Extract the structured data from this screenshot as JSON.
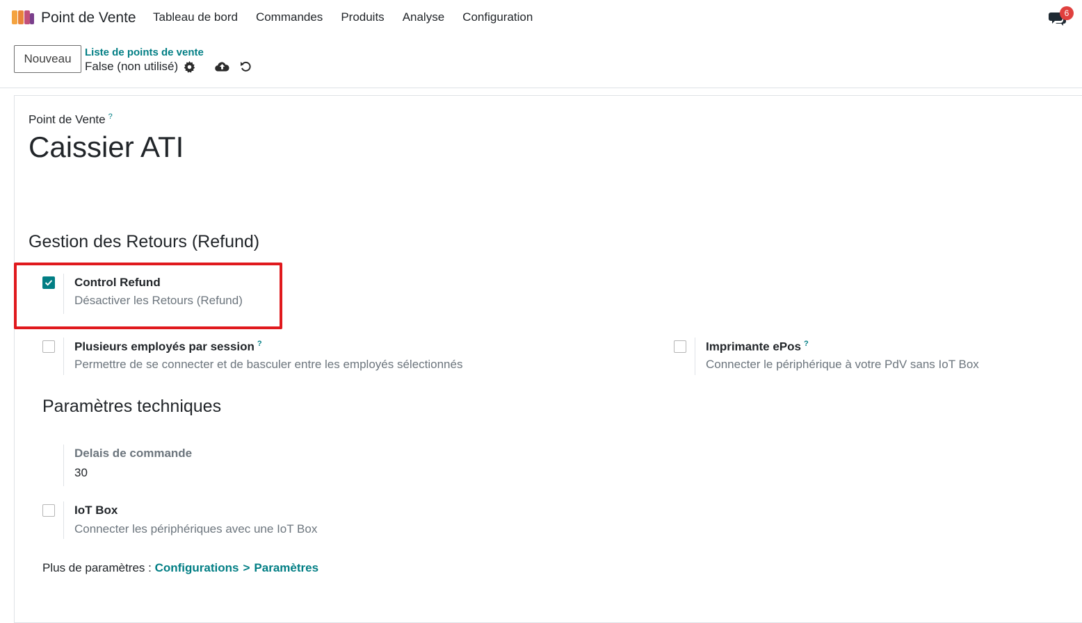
{
  "navbar": {
    "app_name": "Point de Vente",
    "menu": [
      "Tableau de bord",
      "Commandes",
      "Produits",
      "Analyse",
      "Configuration"
    ],
    "messages_count": "6"
  },
  "control_panel": {
    "new_button": "Nouveau",
    "breadcrumb": "Liste de points de vente",
    "record_name": "False (non utilisé)"
  },
  "form": {
    "field_label": "Point de Vente",
    "help_mark": "?",
    "title": "Caissier ATI",
    "section_refund": "Gestion des Retours (Refund)",
    "control_refund": {
      "label": "Control Refund",
      "description": "Désactiver les Retours (Refund)",
      "checked": true
    },
    "multi_employees": {
      "label": "Plusieurs employés par session",
      "description": "Permettre de se connecter et de basculer entre les employés sélectionnés",
      "checked": false
    },
    "epos_printer": {
      "label": "Imprimante ePos",
      "description": "Connecter le périphérique à votre PdV sans IoT Box",
      "checked": false
    },
    "section_tech": "Paramètres techniques",
    "order_delay": {
      "label": "Delais de commande",
      "value": "30"
    },
    "iot_box": {
      "label": "IoT Box",
      "description": "Connecter les périphériques avec une IoT Box",
      "checked": false
    },
    "footer": {
      "prefix": "Plus de paramètres :",
      "link1": "Configurations",
      "separator": ">",
      "link2": "Paramètres"
    }
  },
  "colors": {
    "accent": "#017e84",
    "highlight": "#e0191d",
    "badge": "#e0403e"
  }
}
